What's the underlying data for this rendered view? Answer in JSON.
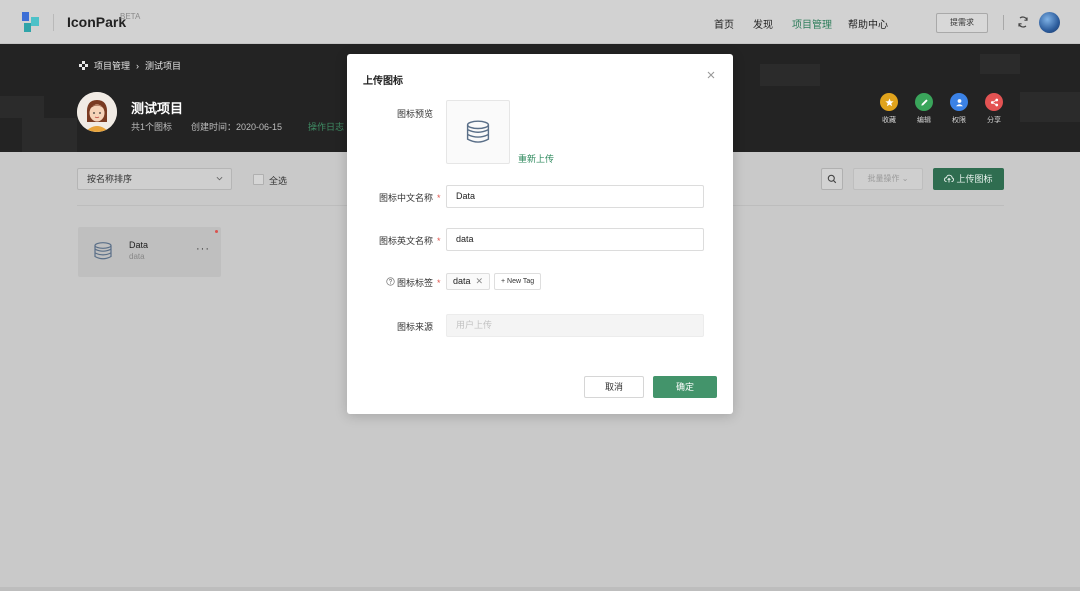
{
  "nav": {
    "logo_text": "IconPark",
    "logo_badge": "BETA",
    "items": [
      {
        "label": "首页",
        "active": false
      },
      {
        "label": "发现",
        "active": false
      },
      {
        "label": "项目管理",
        "active": true
      },
      {
        "label": "帮助中心",
        "active": false
      }
    ],
    "request_button": "提需求"
  },
  "banner": {
    "breadcrumb": {
      "root": "项目管理",
      "separator": "›",
      "current": "测试项目"
    },
    "project_title": "测试项目",
    "icon_count": "共1个图标",
    "created": "创建时间：2020-06-15",
    "log_link": "操作日志",
    "actions": [
      {
        "label": "收藏",
        "color": "#e0a31c",
        "icon": "star-icon"
      },
      {
        "label": "编辑",
        "color": "#3aa55b",
        "icon": "edit-icon"
      },
      {
        "label": "权限",
        "color": "#3b82e6",
        "icon": "user-icon"
      },
      {
        "label": "分享",
        "color": "#e35353",
        "icon": "share-icon"
      }
    ]
  },
  "toolbar": {
    "sort_value": "按名称排序",
    "select_all": "全选",
    "batch_label": "批量操作",
    "upload_label": "上传图标"
  },
  "cards": [
    {
      "name": "Data",
      "sub": "data"
    }
  ],
  "modal": {
    "title": "上传图标",
    "preview_label": "图标预览",
    "reupload": "重新上传",
    "cn_name_label": "图标中文名称",
    "cn_name_value": "Data",
    "en_name_label": "图标英文名称",
    "en_name_value": "data",
    "tags_label": "图标标签",
    "tags": [
      "data"
    ],
    "new_tag": "+ New Tag",
    "source_label": "图标来源",
    "source_placeholder": "用户上传",
    "required_mark": "*",
    "cancel": "取消",
    "ok": "确定"
  },
  "colors": {
    "accent": "#43946b",
    "required": "#e0554d"
  }
}
